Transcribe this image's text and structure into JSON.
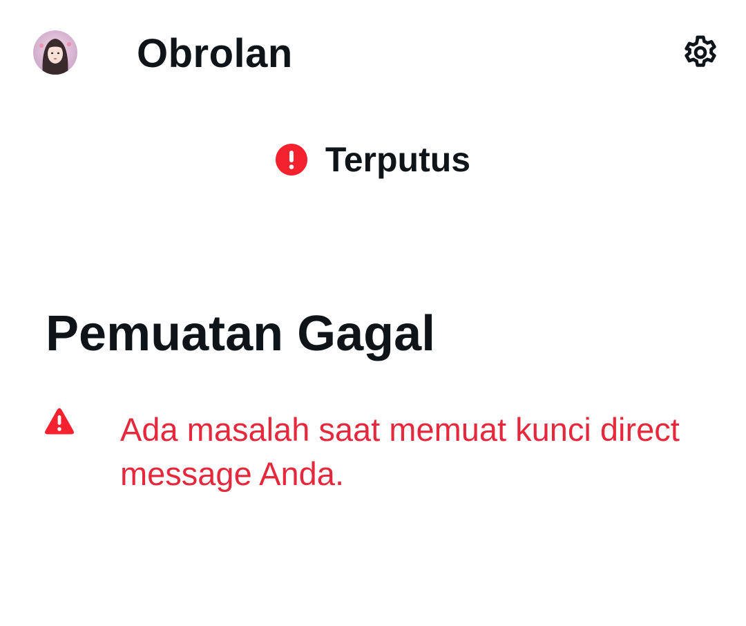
{
  "header": {
    "title": "Obrolan",
    "avatar_icon": "user-avatar",
    "settings_icon": "gear-icon"
  },
  "connection_status": {
    "icon": "alert-circle-icon",
    "text": "Terputus",
    "icon_color": "#F4212E"
  },
  "error": {
    "title": "Pemuatan Gagal",
    "icon": "warning-triangle-icon",
    "message": "Ada masalah saat memuat kunci direct message Anda.",
    "message_color": "#E5283C"
  }
}
